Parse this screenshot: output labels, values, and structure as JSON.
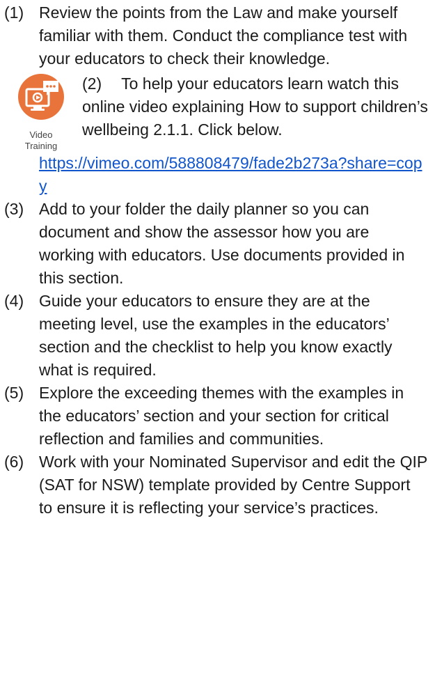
{
  "items": [
    {
      "num": "(1)",
      "text": "Review the points from the Law and make yourself familiar with them. Conduct the compliance test with your educators to check their knowledge."
    },
    {
      "num": "(2)",
      "text": "To help your educators learn watch this online video explaining How to support children’s wellbeing 2.1.1. Click below.",
      "badge_label_1": "Video",
      "badge_label_2": "Training",
      "link": "https://vimeo.com/588808479/fade2b273a?share=copy",
      "icon": "video-training-icon"
    },
    {
      "num": "(3)",
      "text": "Add to your folder the daily planner so you can document and show the assessor how you are working with educators. Use documents provided in this section."
    },
    {
      "num": "(4)",
      "text": "Guide your educators to ensure they are at the meeting level, use the examples in the educators’ section and the checklist to help you know exactly what is required."
    },
    {
      "num": "(5)",
      "text": "Explore the exceeding themes with the examples in the educators’ section and your section for critical reflection and families and communities."
    },
    {
      "num": "(6)",
      "text": "Work with your Nominated Supervisor and edit the QIP (SAT for NSW) template provided by Centre Support to ensure it is reflecting your service’s practices."
    }
  ],
  "colors": {
    "badge": "#e8743b",
    "link": "#1155cc"
  }
}
